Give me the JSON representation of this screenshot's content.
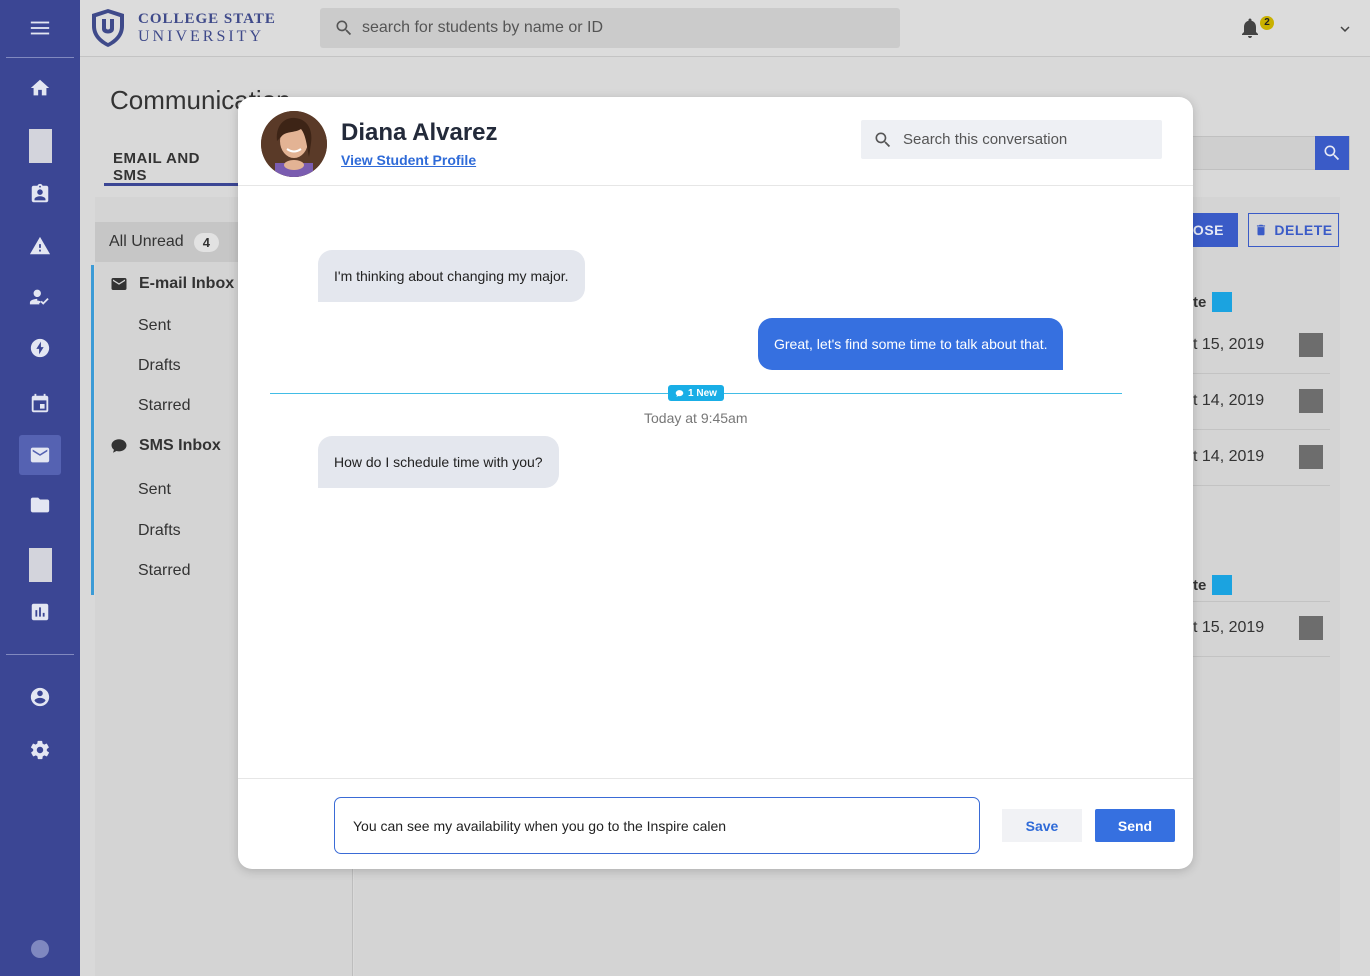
{
  "topbar": {
    "logo_line1": "COLLEGE STATE",
    "logo_line2": "UNIVERSITY",
    "search_placeholder": "search for students by name or ID",
    "notification_count": "2"
  },
  "nav": {
    "icons": [
      "menu-icon",
      "home-icon",
      "placeholder-block",
      "id-badge-icon",
      "warning-icon",
      "person-check-icon",
      "bolt-icon",
      "calendar-icon",
      "mail-icon",
      "folder-icon",
      "placeholder-block",
      "bar-chart-icon",
      "account-icon",
      "gear-icon"
    ],
    "active": "mail-icon"
  },
  "page": {
    "title": "Communication",
    "tab": "EMAIL AND SMS"
  },
  "folders": {
    "all_unread_label": "All Unread",
    "all_unread_count": "4",
    "email_inbox": "E-mail Inbox",
    "email_sent": "Sent",
    "email_drafts": "Drafts",
    "email_starred": "Starred",
    "sms_inbox": "SMS Inbox",
    "sms_sent": "Sent",
    "sms_drafts": "Drafts",
    "sms_starred": "Starred"
  },
  "list": {
    "compose_label": "POSE",
    "delete_label": "DELETE",
    "column_header": "te",
    "rows_group1": [
      "t 15, 2019",
      "t 14, 2019",
      "t 14, 2019"
    ],
    "rows_group2": [
      "t 15, 2019"
    ]
  },
  "modal": {
    "student_name": "Diana Alvarez",
    "profile_link": "View Student Profile",
    "search_placeholder": "Search this conversation",
    "messages": [
      {
        "direction": "in",
        "text": "I'm thinking about changing my major."
      },
      {
        "direction": "out",
        "text": "Great, let's find some time to talk about that."
      },
      {
        "direction": "in",
        "text": "How do I schedule time with you?"
      }
    ],
    "new_badge": "1 New",
    "divider_time": "Today at 9:45am",
    "composer_value": "You can see my availability when you go to the Inspire calen",
    "save_label": "Save",
    "send_label": "Send"
  },
  "colors": {
    "nav_bg": "#3b4694",
    "primary": "#3670e0",
    "new_line": "#42bde6",
    "incoming_bubble": "#e4e7ee"
  }
}
